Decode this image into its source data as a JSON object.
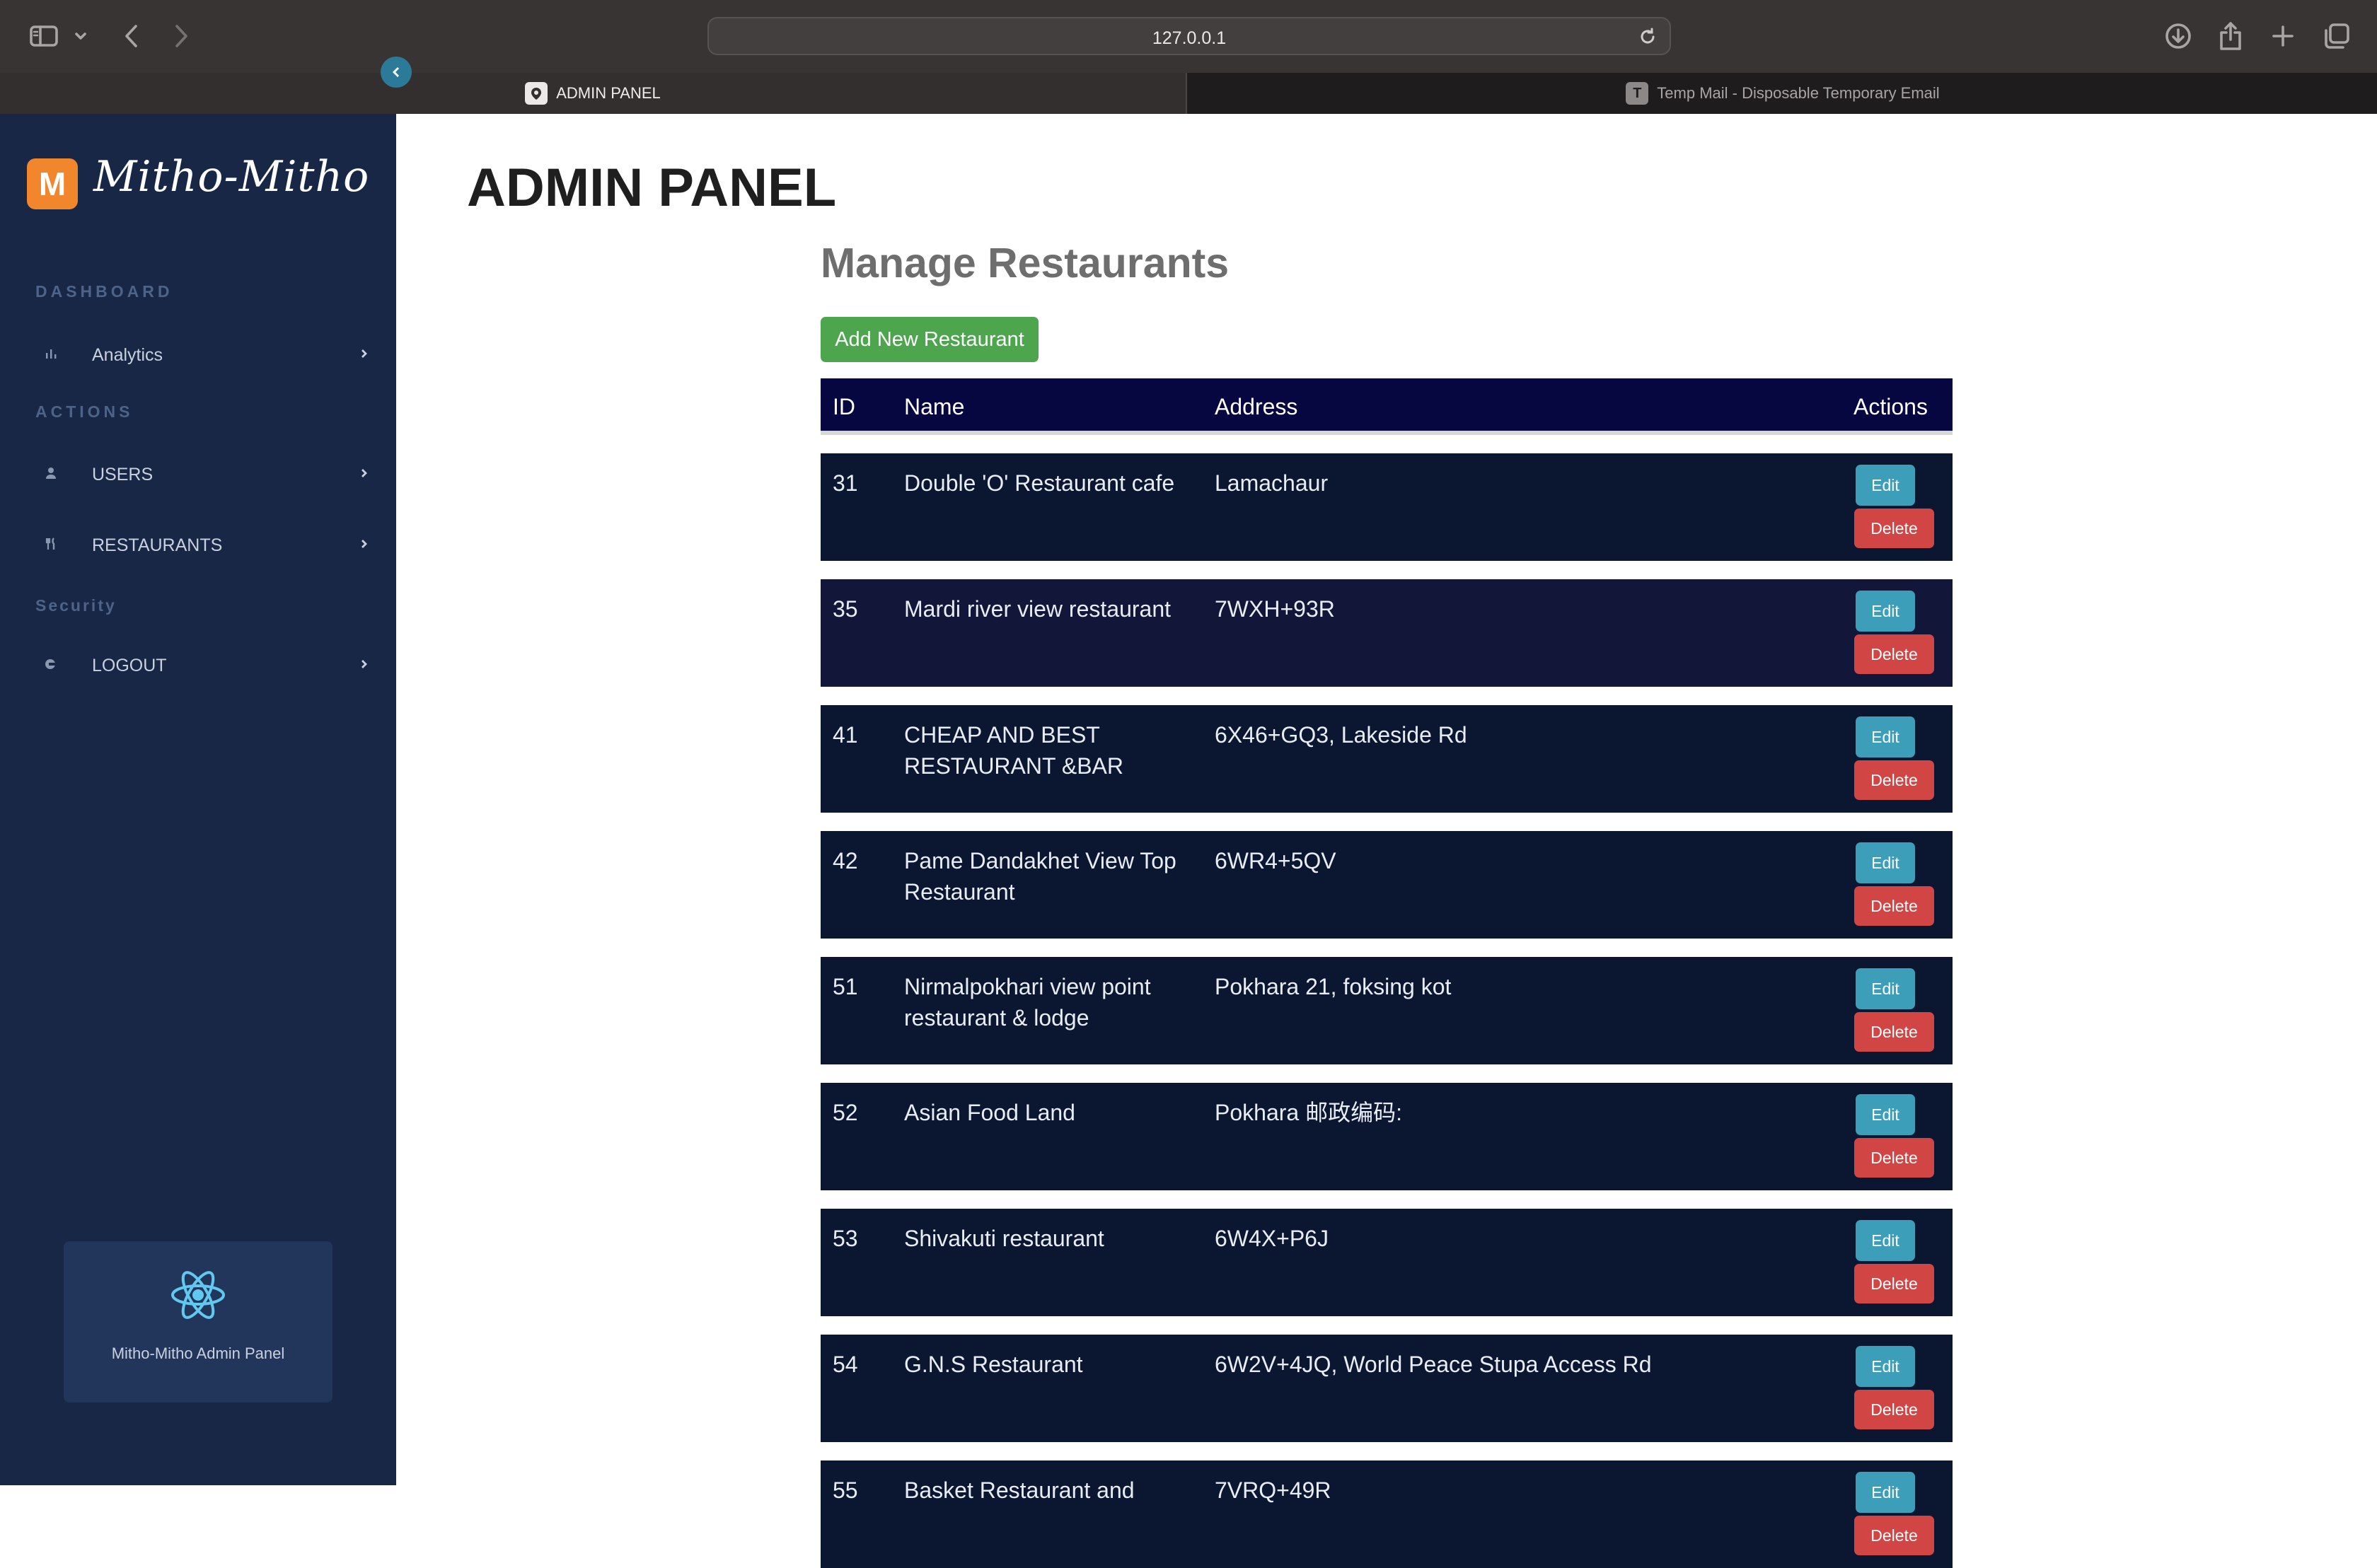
{
  "browser": {
    "url": "127.0.0.1",
    "tabs": [
      {
        "label": "ADMIN PANEL",
        "active": true
      },
      {
        "label": "Temp Mail - Disposable Temporary Email",
        "active": false,
        "favicon_letter": "T"
      }
    ]
  },
  "sidebar": {
    "logo_letter": "M",
    "brand": "Mitho-Mitho",
    "sections": [
      {
        "heading": "DASHBOARD",
        "items": [
          {
            "label": "Analytics",
            "icon": "bar-chart-icon"
          }
        ]
      },
      {
        "heading": "ACTIONS",
        "items": [
          {
            "label": "USERS",
            "icon": "user-icon"
          },
          {
            "label": "RESTAURANTS",
            "icon": "cutlery-icon"
          }
        ]
      },
      {
        "heading": "Security",
        "items": [
          {
            "label": "LOGOUT",
            "icon": "logout-icon"
          }
        ]
      }
    ],
    "promo_text": "Mitho-Mitho Admin Panel",
    "promo_icon": "react-atom-icon"
  },
  "main": {
    "title": "ADMIN PANEL",
    "subtitle": "Manage Restaurants",
    "add_button": "Add New Restaurant",
    "columns": [
      "ID",
      "Name",
      "Address",
      "Actions"
    ],
    "edit_label": "Edit",
    "delete_label": "Delete",
    "rows": [
      {
        "id": "31",
        "name": "Double 'O' Restaurant cafe",
        "address": "Lamachaur"
      },
      {
        "id": "35",
        "name": "Mardi river view restaurant",
        "address": "7WXH+93R"
      },
      {
        "id": "41",
        "name": "CHEAP AND BEST RESTAURANT &BAR",
        "address": "6X46+GQ3, Lakeside Rd"
      },
      {
        "id": "42",
        "name": "Pame Dandakhet View Top Restaurant",
        "address": "6WR4+5QV"
      },
      {
        "id": "51",
        "name": "Nirmalpokhari view point restaurant & lodge",
        "address": "Pokhara 21, foksing kot"
      },
      {
        "id": "52",
        "name": "Asian Food Land",
        "address": "Pokhara 邮政编码:"
      },
      {
        "id": "53",
        "name": "Shivakuti restaurant",
        "address": "6W4X+P6J"
      },
      {
        "id": "54",
        "name": "G.N.S Restaurant",
        "address": "6W2V+4JQ, World Peace Stupa Access Rd"
      },
      {
        "id": "55",
        "name": "Basket Restaurant and",
        "address": "7VRQ+49R"
      }
    ]
  },
  "colors": {
    "sidebar_bg": "#182745",
    "table_header_bg": "#060640",
    "row_bg": "#0b1730",
    "row_bg_alt": "#121638",
    "add_button": "#4da64d",
    "edit_button": "#3d9eb9",
    "delete_button": "#d24545",
    "logo_accent": "#f2862d"
  }
}
